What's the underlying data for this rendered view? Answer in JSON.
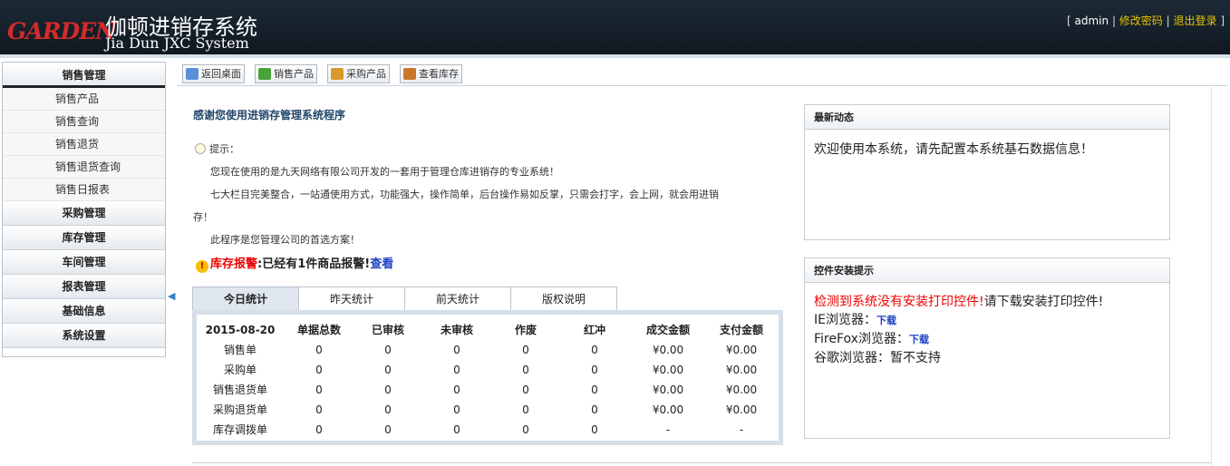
{
  "header": {
    "logo_mark": "GARDEN",
    "title_cn": "伽顿进销存系统",
    "title_en": "Jia Dun JXC System",
    "user": "admin",
    "change_pwd": "修改密码",
    "logout": "退出登录"
  },
  "sidebar": {
    "head": "销售管理",
    "sub_items": [
      "销售产品",
      "销售查询",
      "销售退货",
      "销售退货查询",
      "销售日报表"
    ],
    "categories": [
      "采购管理",
      "库存管理",
      "车间管理",
      "报表管理",
      "基础信息",
      "系统设置"
    ]
  },
  "toolbar": {
    "items": [
      {
        "label": "返回桌面",
        "icon": "desktop-icon",
        "color": "#5b8fd6"
      },
      {
        "label": "销售产品",
        "icon": "sell-icon",
        "color": "#4aa23a"
      },
      {
        "label": "采购产品",
        "icon": "purchase-icon",
        "color": "#d99a2b"
      },
      {
        "label": "查看库存",
        "icon": "stock-icon",
        "color": "#c9762c"
      }
    ]
  },
  "main": {
    "welcome": "感谢您使用进销存管理系统程序",
    "tip_label": "提示：",
    "para1": "您现在使用的是九天网络有限公司开发的一套用于管理仓库进销存的专业系统！",
    "para2a": "七大栏目完美整合，一站通使用方式，功能强大，操作简单，后台操作易如反掌，只需会打字，会上网，就会用进销",
    "para2b": "存！",
    "para3": "此程序是您管理公司的首选方案！",
    "alarm_label": "库存报警",
    "alarm_text": ":已经有1件商品报警!",
    "alarm_link": "查看"
  },
  "stats": {
    "tabs": [
      "今日统计",
      "昨天统计",
      "前天统计",
      "版权说明"
    ],
    "headers": [
      "2015-08-20",
      "单据总数",
      "已审核",
      "未审核",
      "作废",
      "红冲",
      "成交金额",
      "支付金额"
    ],
    "rows": [
      [
        "销售单",
        "0",
        "0",
        "0",
        "0",
        "0",
        "¥0.00",
        "¥0.00"
      ],
      [
        "采购单",
        "0",
        "0",
        "0",
        "0",
        "0",
        "¥0.00",
        "¥0.00"
      ],
      [
        "销售退货单",
        "0",
        "0",
        "0",
        "0",
        "0",
        "¥0.00",
        "¥0.00"
      ],
      [
        "采购退货单",
        "0",
        "0",
        "0",
        "0",
        "0",
        "¥0.00",
        "¥0.00"
      ],
      [
        "库存调拨单",
        "0",
        "0",
        "0",
        "0",
        "0",
        "-",
        "-"
      ]
    ]
  },
  "news": {
    "title": "最新动态",
    "text": "欢迎使用本系统，请先配置本系统基石数据信息！"
  },
  "plugin": {
    "title": "控件安装提示",
    "warn": "检测到系统没有安装打印控件!",
    "warn_rest": "请下载安装打印控件!",
    "ie_label": "IE浏览器：",
    "ff_label": "FireFox浏览器：",
    "download": "下载",
    "chrome": "谷歌浏览器：暂不支持"
  }
}
